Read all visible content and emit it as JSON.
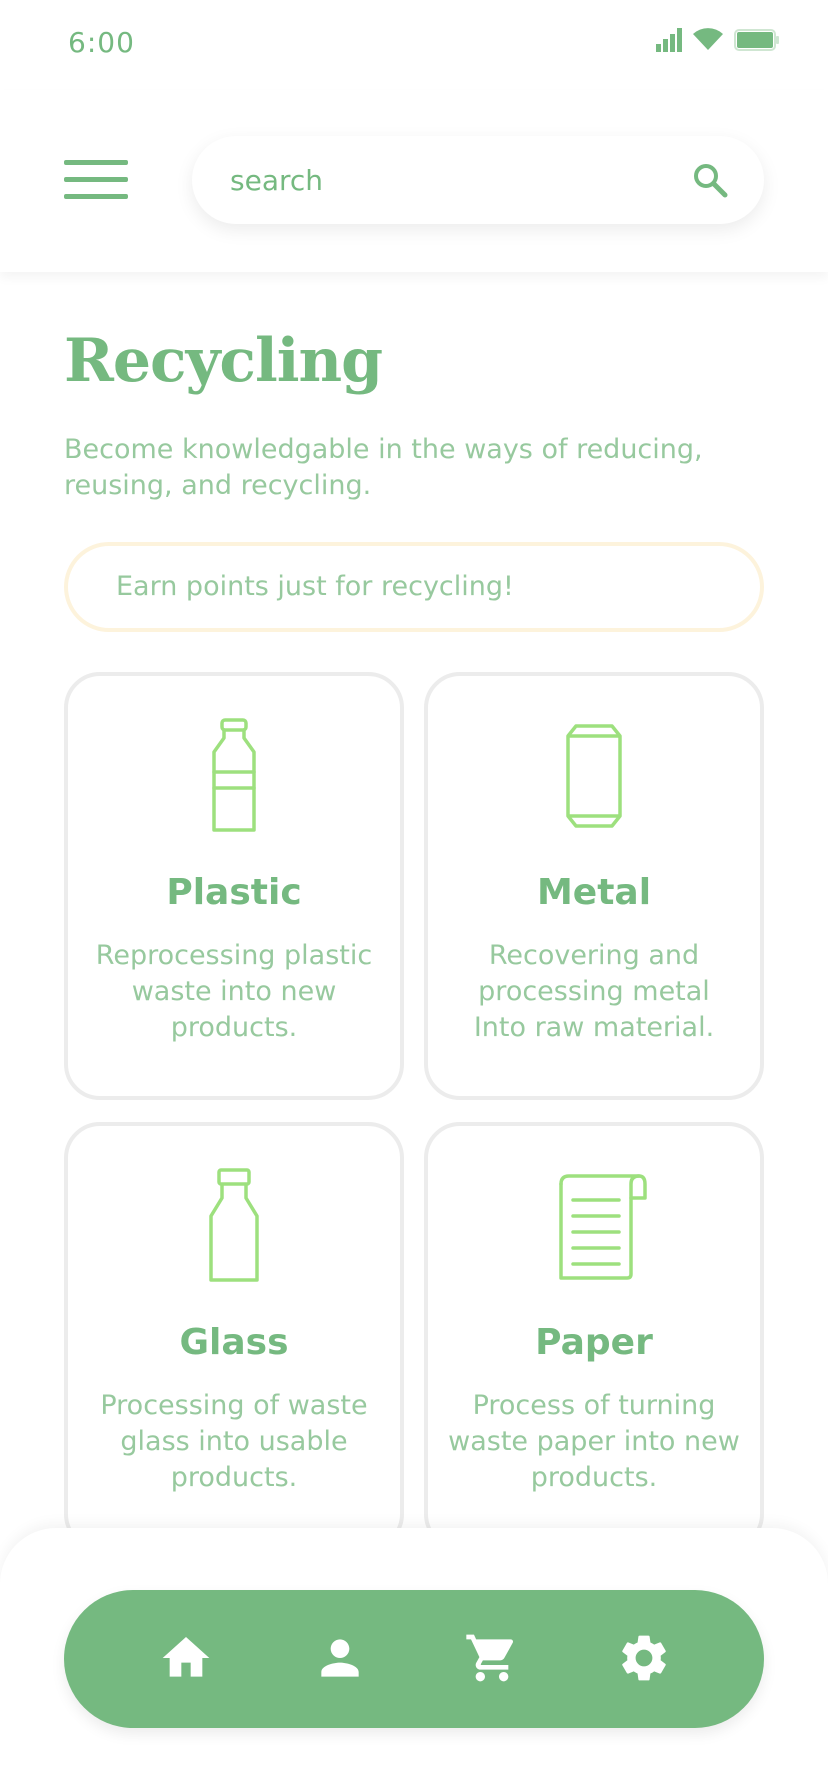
{
  "status_bar": {
    "time": "6:00"
  },
  "search": {
    "placeholder": "search"
  },
  "page": {
    "title": "Recycling",
    "subtitle": "Become knowledgable in the ways of reducing, reusing, and recycling."
  },
  "promo": {
    "text": "Earn points just for recycling!"
  },
  "categories": [
    {
      "title": "Plastic",
      "description": "Reprocessing plastic waste into new products.",
      "icon": "plastic-bottle-icon"
    },
    {
      "title": "Metal",
      "description": "Recovering and processing metal Into raw material.",
      "icon": "metal-can-icon"
    },
    {
      "title": "Glass",
      "description": "Processing of waste glass into usable products.",
      "icon": "glass-bottle-icon"
    },
    {
      "title": "Paper",
      "description": "Process of turning waste paper into new products.",
      "icon": "paper-scroll-icon"
    }
  ],
  "bottom_nav": [
    {
      "icon": "home-icon"
    },
    {
      "icon": "profile-icon"
    },
    {
      "icon": "cart-icon"
    },
    {
      "icon": "settings-icon"
    }
  ],
  "colors": {
    "primary": "#75b980",
    "text_light": "#97c99e",
    "icon_green": "#9de07e",
    "card_border": "#ececec",
    "promo_border": "#fdf3dc"
  }
}
